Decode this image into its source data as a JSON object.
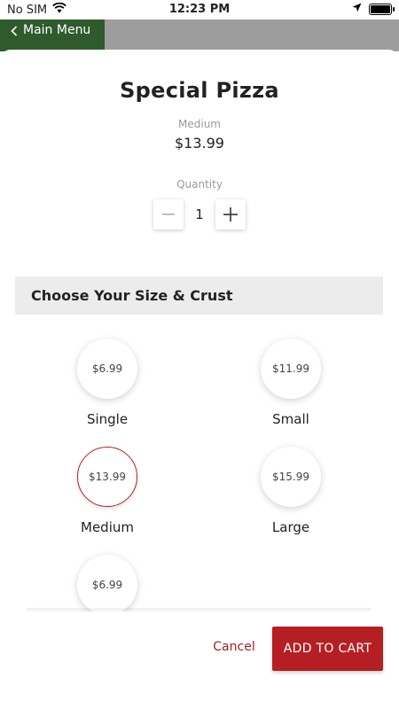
{
  "status_bar": {
    "carrier": "No SIM",
    "time": "12:23 PM"
  },
  "nav": {
    "back_label": "Main Menu",
    "tab_color": "#2f5a2c"
  },
  "product": {
    "title": "Special Pizza",
    "size": "Medium",
    "price": "$13.99",
    "quantity_label": "Quantity",
    "quantity": "1"
  },
  "section": {
    "title": "Choose Your Size & Crust"
  },
  "options": [
    {
      "name": "Single",
      "price": "$6.99",
      "selected": false
    },
    {
      "name": "Small",
      "price": "$11.99",
      "selected": false
    },
    {
      "name": "Medium",
      "price": "$13.99",
      "selected": true
    },
    {
      "name": "Large",
      "price": "$15.99",
      "selected": false
    },
    {
      "name": "",
      "price": "$6.99",
      "selected": false
    }
  ],
  "footer": {
    "cancel_label": "Cancel",
    "add_to_cart_label": "ADD TO CART",
    "accent_color": "#b51f24"
  }
}
